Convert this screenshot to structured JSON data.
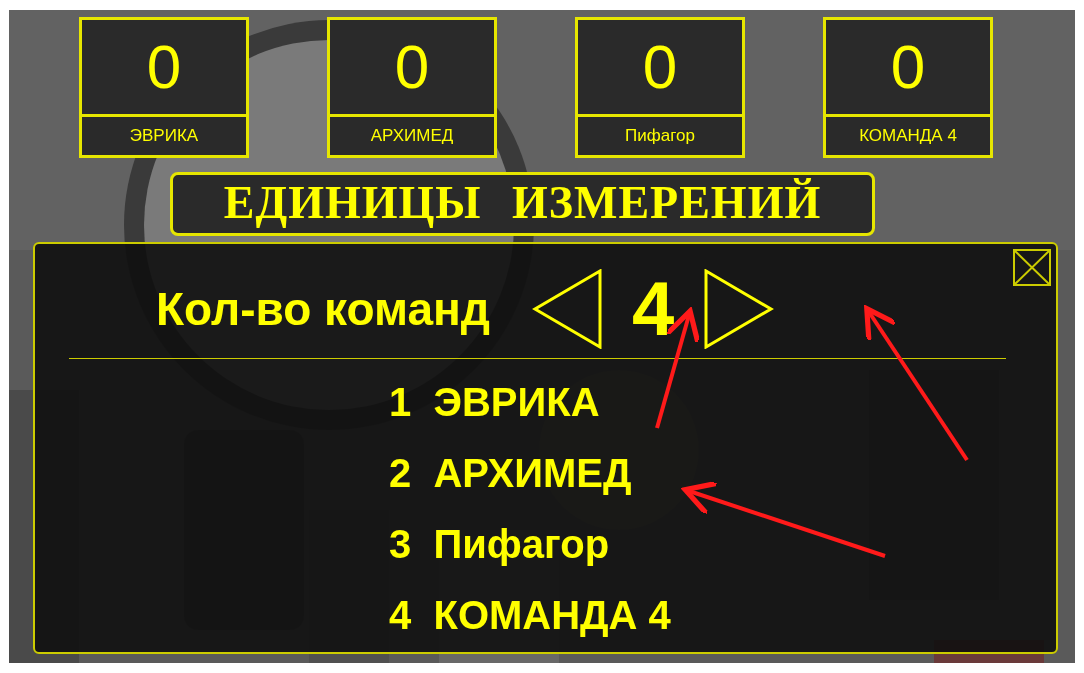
{
  "scoreboard": [
    {
      "score": "0",
      "team": "ЭВРИКА"
    },
    {
      "score": "0",
      "team": "АРХИМЕД"
    },
    {
      "score": "0",
      "team": "Пифагор"
    },
    {
      "score": "0",
      "team": "КОМАНДА 4"
    }
  ],
  "title": "ЕДИНИЦЫ ИЗМЕРЕНИЙ",
  "panel": {
    "label": "Кол-во команд",
    "count": "4",
    "teams": [
      {
        "number": "1",
        "name": "ЭВРИКА"
      },
      {
        "number": "2",
        "name": "АРХИМЕД"
      },
      {
        "number": "3",
        "name": "Пифагор"
      },
      {
        "number": "4",
        "name": "КОМАНДА 4"
      }
    ]
  }
}
